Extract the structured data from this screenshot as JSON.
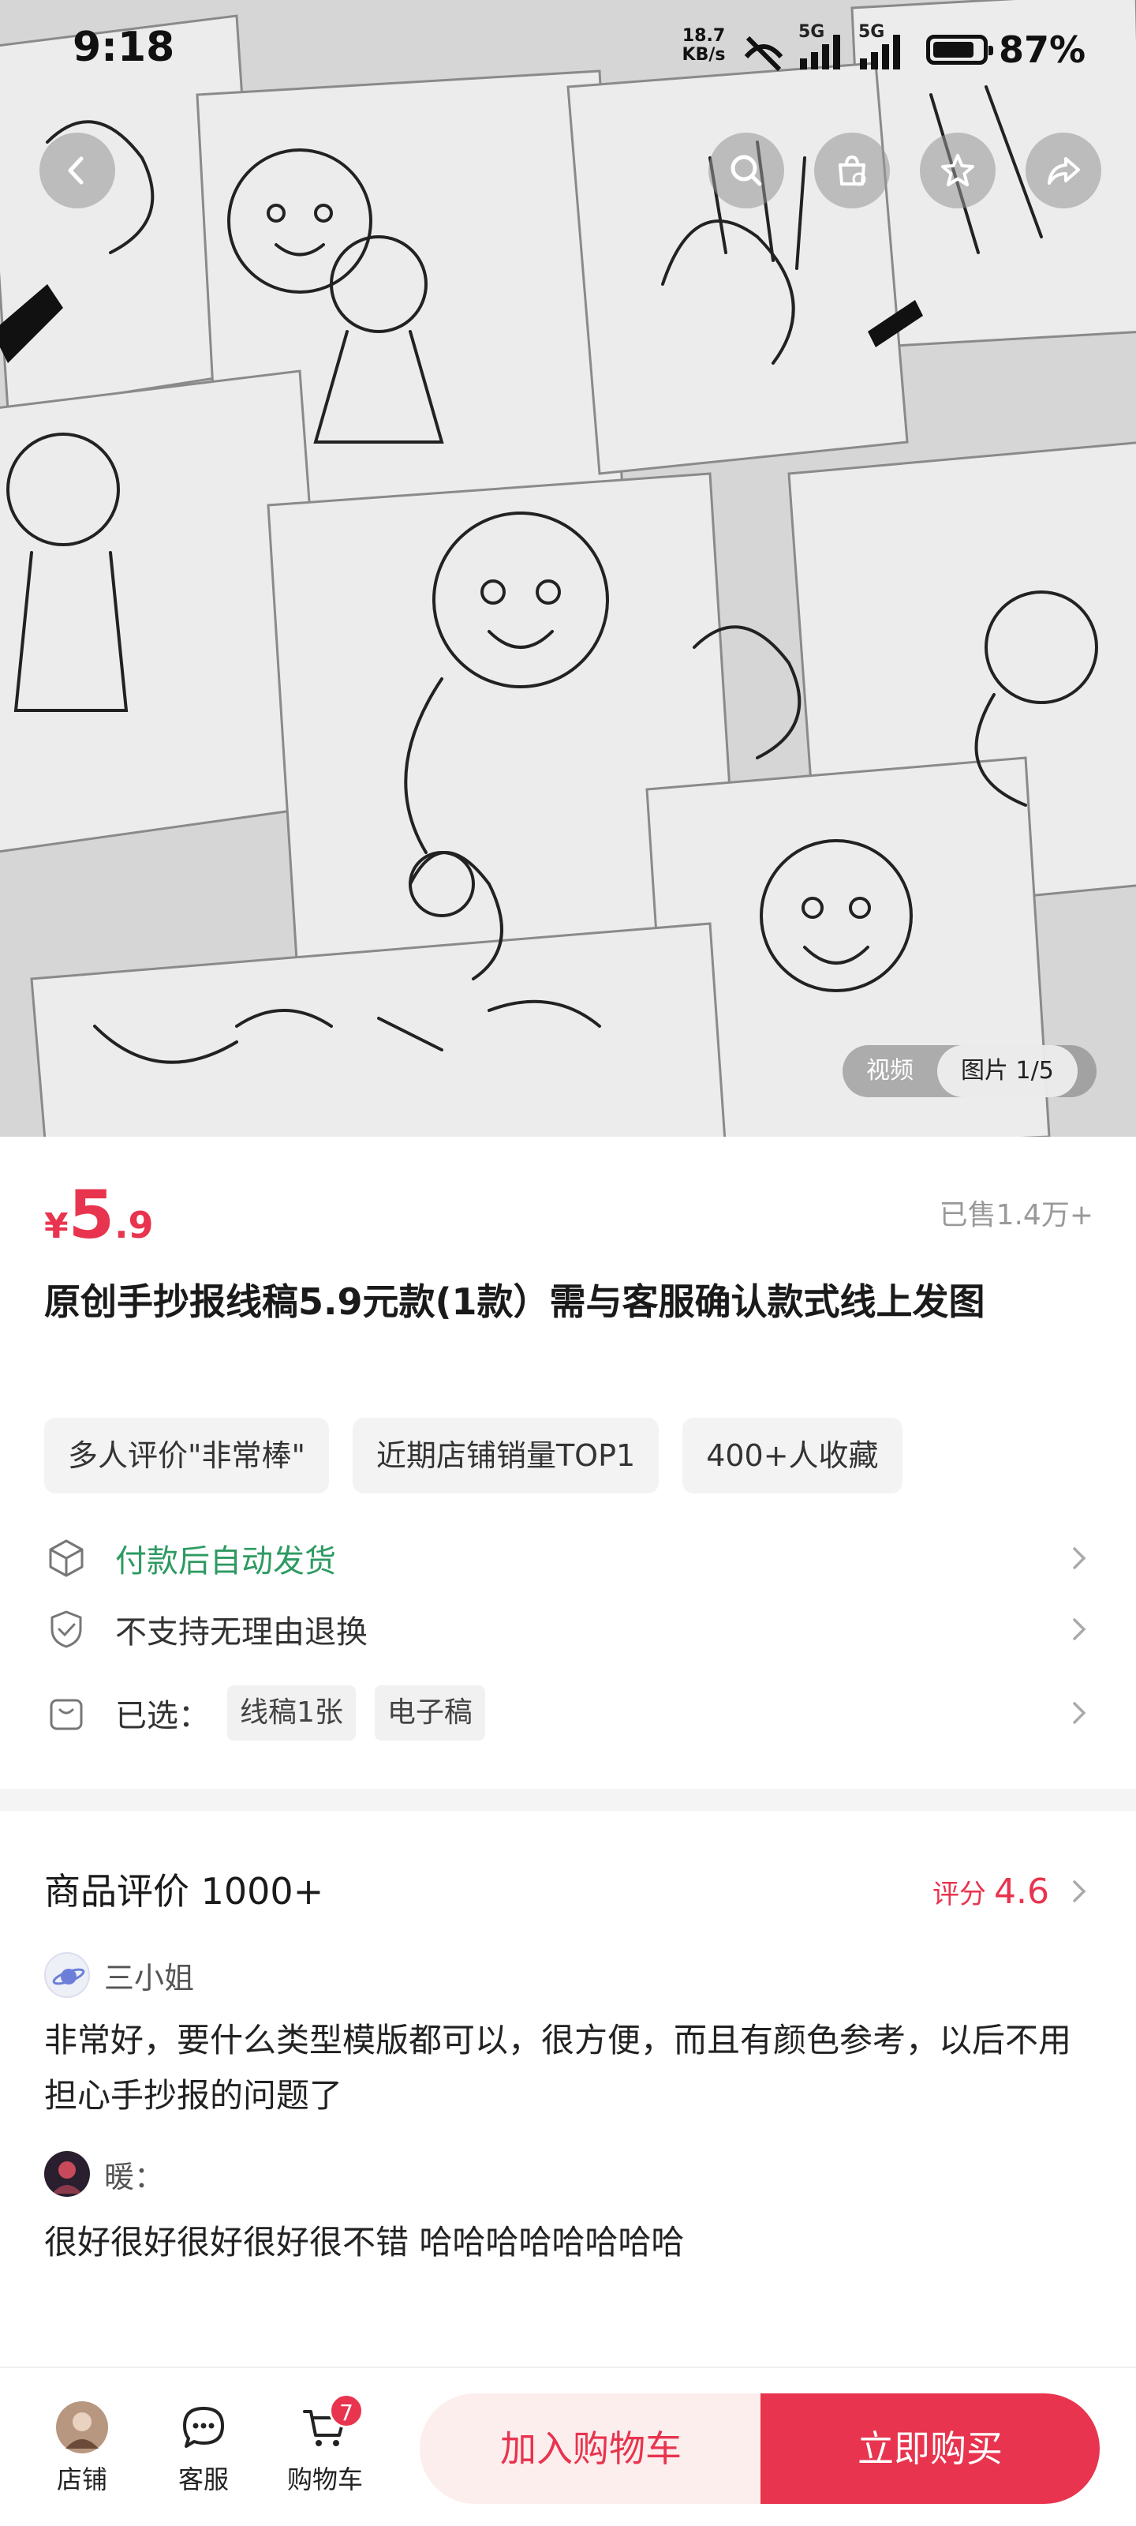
{
  "status_bar": {
    "time": "9:18",
    "net_speed_value": "18.7",
    "net_speed_unit": "KB/s",
    "signal_1_label": "5G",
    "signal_2_label": "5G",
    "battery_percent": "87%",
    "battery_level": 0.87
  },
  "top_nav": {
    "icons": [
      "back-icon",
      "search-icon",
      "shop-icon",
      "star-icon",
      "share-icon"
    ]
  },
  "gallery": {
    "tab_video": "视频",
    "tab_images": "图片 1/5"
  },
  "product": {
    "price_currency": "¥",
    "price_int": "5",
    "price_dec": ".9",
    "sold": "已售1.4万+",
    "title": "原创手抄报线稿5.9元款(1款）需与客服确认款式线上发图",
    "tags": [
      "多人评价\"非常棒\"",
      "近期店铺销量TOP1",
      "400+人收藏"
    ]
  },
  "services": {
    "shipping": "付款后自动发货",
    "returns": "不支持无理由退换",
    "selected_label": "已选：",
    "selected_options": [
      "线稿1张",
      "电子稿"
    ]
  },
  "reviews": {
    "title": "商品评价 1000+",
    "score_label": "评分",
    "score_value": "4.6",
    "items": [
      {
        "name": "三小姐",
        "text": "非常好，要什么类型模版都可以，很方便，而且有颜色参考，以后不用担心手抄报的问题了"
      },
      {
        "name": "暖：",
        "text": "很好很好很好很好很不错 哈哈哈哈哈哈哈哈"
      }
    ]
  },
  "bottom_bar": {
    "shop_label": "店铺",
    "service_label": "客服",
    "cart_label": "购物车",
    "cart_count": "7",
    "add_to_cart": "加入购物车",
    "buy_now": "立即购买"
  },
  "colors": {
    "accent": "#e8344e",
    "green": "#2e9a62"
  }
}
